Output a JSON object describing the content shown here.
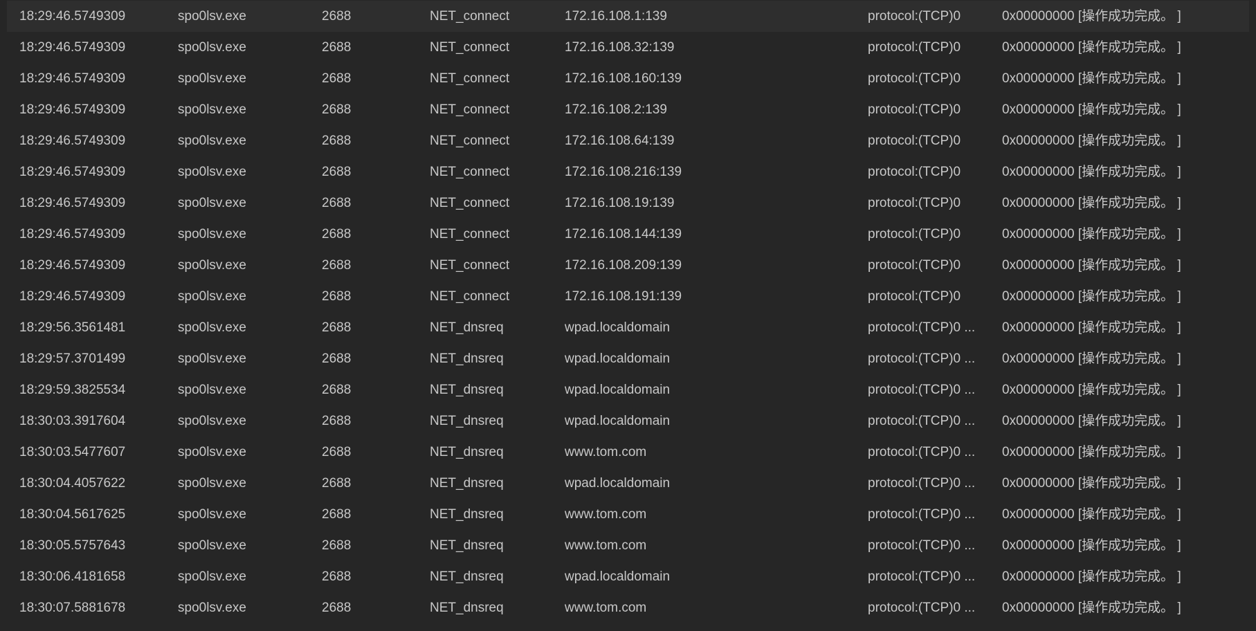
{
  "rows": [
    {
      "time": "18:29:46.5749309",
      "process": "spo0lsv.exe",
      "pid": "2688",
      "operation": "NET_connect",
      "path": "172.16.108.1:139",
      "detail": "protocol:(TCP)0",
      "result": "0x00000000 [操作成功完成。 ]"
    },
    {
      "time": "18:29:46.5749309",
      "process": "spo0lsv.exe",
      "pid": "2688",
      "operation": "NET_connect",
      "path": "172.16.108.32:139",
      "detail": "protocol:(TCP)0",
      "result": "0x00000000 [操作成功完成。 ]"
    },
    {
      "time": "18:29:46.5749309",
      "process": "spo0lsv.exe",
      "pid": "2688",
      "operation": "NET_connect",
      "path": "172.16.108.160:139",
      "detail": "protocol:(TCP)0",
      "result": "0x00000000 [操作成功完成。 ]"
    },
    {
      "time": "18:29:46.5749309",
      "process": "spo0lsv.exe",
      "pid": "2688",
      "operation": "NET_connect",
      "path": "172.16.108.2:139",
      "detail": "protocol:(TCP)0",
      "result": "0x00000000 [操作成功完成。 ]"
    },
    {
      "time": "18:29:46.5749309",
      "process": "spo0lsv.exe",
      "pid": "2688",
      "operation": "NET_connect",
      "path": "172.16.108.64:139",
      "detail": "protocol:(TCP)0",
      "result": "0x00000000 [操作成功完成。 ]"
    },
    {
      "time": "18:29:46.5749309",
      "process": "spo0lsv.exe",
      "pid": "2688",
      "operation": "NET_connect",
      "path": "172.16.108.216:139",
      "detail": "protocol:(TCP)0",
      "result": "0x00000000 [操作成功完成。 ]"
    },
    {
      "time": "18:29:46.5749309",
      "process": "spo0lsv.exe",
      "pid": "2688",
      "operation": "NET_connect",
      "path": "172.16.108.19:139",
      "detail": "protocol:(TCP)0",
      "result": "0x00000000 [操作成功完成。 ]"
    },
    {
      "time": "18:29:46.5749309",
      "process": "spo0lsv.exe",
      "pid": "2688",
      "operation": "NET_connect",
      "path": "172.16.108.144:139",
      "detail": "protocol:(TCP)0",
      "result": "0x00000000 [操作成功完成。 ]"
    },
    {
      "time": "18:29:46.5749309",
      "process": "spo0lsv.exe",
      "pid": "2688",
      "operation": "NET_connect",
      "path": "172.16.108.209:139",
      "detail": "protocol:(TCP)0",
      "result": "0x00000000 [操作成功完成。 ]"
    },
    {
      "time": "18:29:46.5749309",
      "process": "spo0lsv.exe",
      "pid": "2688",
      "operation": "NET_connect",
      "path": "172.16.108.191:139",
      "detail": "protocol:(TCP)0",
      "result": "0x00000000 [操作成功完成。 ]"
    },
    {
      "time": "18:29:56.3561481",
      "process": "spo0lsv.exe",
      "pid": "2688",
      "operation": "NET_dnsreq",
      "path": "wpad.localdomain",
      "detail": "protocol:(TCP)0 ...",
      "result": "0x00000000 [操作成功完成。 ]"
    },
    {
      "time": "18:29:57.3701499",
      "process": "spo0lsv.exe",
      "pid": "2688",
      "operation": "NET_dnsreq",
      "path": "wpad.localdomain",
      "detail": "protocol:(TCP)0 ...",
      "result": "0x00000000 [操作成功完成。 ]"
    },
    {
      "time": "18:29:59.3825534",
      "process": "spo0lsv.exe",
      "pid": "2688",
      "operation": "NET_dnsreq",
      "path": "wpad.localdomain",
      "detail": "protocol:(TCP)0 ...",
      "result": "0x00000000 [操作成功完成。 ]"
    },
    {
      "time": "18:30:03.3917604",
      "process": "spo0lsv.exe",
      "pid": "2688",
      "operation": "NET_dnsreq",
      "path": "wpad.localdomain",
      "detail": "protocol:(TCP)0 ...",
      "result": "0x00000000 [操作成功完成。 ]"
    },
    {
      "time": "18:30:03.5477607",
      "process": "spo0lsv.exe",
      "pid": "2688",
      "operation": "NET_dnsreq",
      "path": "www.tom.com",
      "detail": "protocol:(TCP)0 ...",
      "result": "0x00000000 [操作成功完成。 ]"
    },
    {
      "time": "18:30:04.4057622",
      "process": "spo0lsv.exe",
      "pid": "2688",
      "operation": "NET_dnsreq",
      "path": "wpad.localdomain",
      "detail": "protocol:(TCP)0 ...",
      "result": "0x00000000 [操作成功完成。 ]"
    },
    {
      "time": "18:30:04.5617625",
      "process": "spo0lsv.exe",
      "pid": "2688",
      "operation": "NET_dnsreq",
      "path": "www.tom.com",
      "detail": "protocol:(TCP)0 ...",
      "result": "0x00000000 [操作成功完成。 ]"
    },
    {
      "time": "18:30:05.5757643",
      "process": "spo0lsv.exe",
      "pid": "2688",
      "operation": "NET_dnsreq",
      "path": "www.tom.com",
      "detail": "protocol:(TCP)0 ...",
      "result": "0x00000000 [操作成功完成。 ]"
    },
    {
      "time": "18:30:06.4181658",
      "process": "spo0lsv.exe",
      "pid": "2688",
      "operation": "NET_dnsreq",
      "path": "wpad.localdomain",
      "detail": "protocol:(TCP)0 ...",
      "result": "0x00000000 [操作成功完成。 ]"
    },
    {
      "time": "18:30:07.5881678",
      "process": "spo0lsv.exe",
      "pid": "2688",
      "operation": "NET_dnsreq",
      "path": "www.tom.com",
      "detail": "protocol:(TCP)0 ...",
      "result": "0x00000000 [操作成功完成。 ]"
    }
  ],
  "selected_row": 0,
  "colors": {
    "background": "#262626",
    "selected_row": "#2e2e2e",
    "text": "#c8c8c8"
  }
}
